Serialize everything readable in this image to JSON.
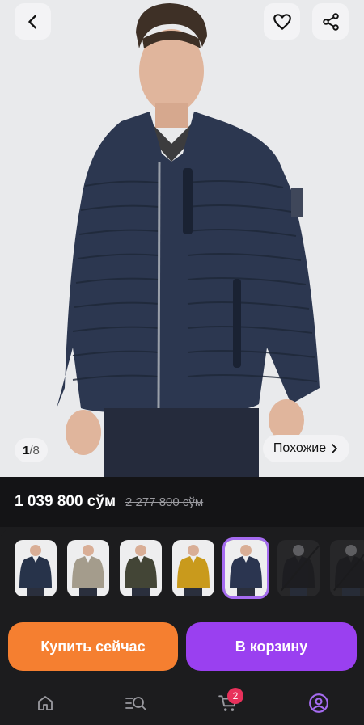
{
  "header": {
    "back_icon": "chevron-left-icon",
    "favorite_icon": "heart-icon",
    "share_icon": "share-icon"
  },
  "gallery": {
    "current": "1",
    "separator": "/",
    "total": "8",
    "similar_label": "Похожие",
    "similar_icon": "chevron-right-icon"
  },
  "price": {
    "current": "1 039 800 сўм",
    "old": "2 277 800 сўм"
  },
  "variants": {
    "items": [
      {
        "color": "navy",
        "swatch": "#27334a",
        "available": true,
        "selected": false
      },
      {
        "color": "beige",
        "swatch": "#a49c8c",
        "available": true,
        "selected": false
      },
      {
        "color": "olive",
        "swatch": "#434536",
        "available": true,
        "selected": false
      },
      {
        "color": "mustard",
        "swatch": "#c99a1c",
        "available": true,
        "selected": false
      },
      {
        "color": "navy",
        "swatch": "#2b3550",
        "available": true,
        "selected": true
      },
      {
        "color": "black",
        "swatch": "#1e1e22",
        "available": false,
        "selected": false
      },
      {
        "color": "black",
        "swatch": "#1e1e22",
        "available": false,
        "selected": false
      }
    ]
  },
  "actions": {
    "buy_now": "Купить сейчас",
    "add_to_cart": "В корзину"
  },
  "bottom_nav": {
    "items": [
      "home-icon",
      "catalog-search-icon",
      "cart-icon",
      "profile-icon"
    ],
    "cart_badge": "2"
  },
  "colors": {
    "buy_button": "#f57f30",
    "cart_button": "#9a40f0",
    "selected_outline": "#a56bf0",
    "badge": "#e8315b",
    "jacket": "#2c3750"
  }
}
